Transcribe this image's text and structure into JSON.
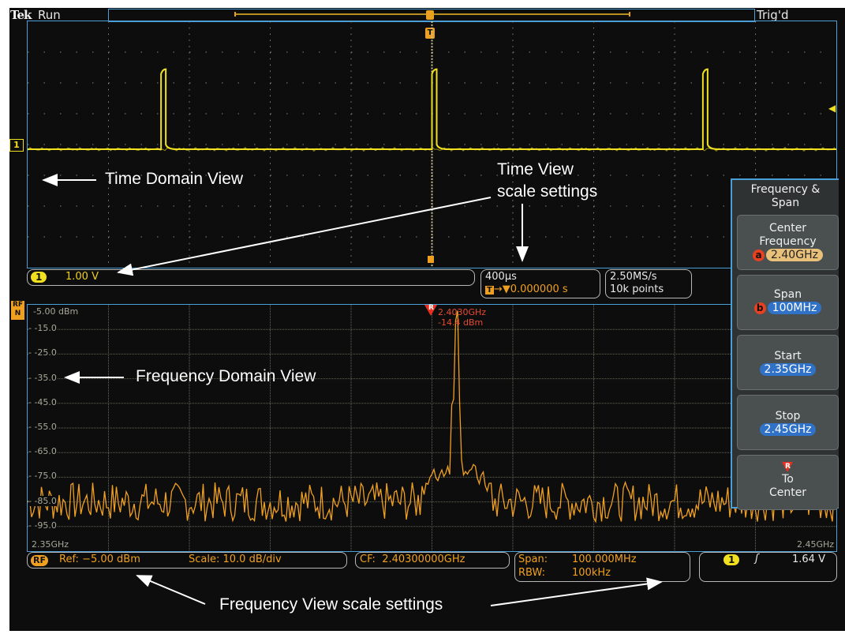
{
  "top_bar": {
    "brand": "Tek",
    "acq_state": "Run",
    "trigger_status": "Trig'd"
  },
  "time_domain": {
    "channel_marker": "1",
    "trigger_marker": "T",
    "channel_color": "#f0e020",
    "pulse_positions_div": [
      1.65,
      5.0,
      8.35
    ],
    "baseline_div_from_top": 4.0,
    "pulse_height_div": 2.6
  },
  "channel_readout": {
    "channel": "1",
    "scale": "1.00 V"
  },
  "horizontal_readout": {
    "time_per_div": "400µs",
    "trigger_icon": "T",
    "position": "0.000000 s"
  },
  "acquisition_readout": {
    "sample_rate": "2.50MS/s",
    "record_length": "10k points"
  },
  "frequency_domain": {
    "rf_marker_top": "RF",
    "rf_marker_bottom": "N",
    "ref_label": "-5.00 dBm",
    "y_tick_labels": [
      "-15.0",
      "-25.0",
      "-35.0",
      "-45.0",
      "-55.0",
      "-65.0",
      "-75.0",
      "-85.0",
      "-95.0"
    ],
    "start_label": "2.35GHz",
    "stop_label": "2.45GHz",
    "trace_color": "#f0a020",
    "marker": {
      "label": "R",
      "frequency": "2.4030GHz",
      "amplitude": "-14.4 dBm",
      "color": "#e83020"
    }
  },
  "chart_data": {
    "type": "line",
    "title": "Frequency Domain View",
    "xlabel": "Frequency",
    "ylabel": "dBm",
    "x_range_ghz": [
      2.35,
      2.45
    ],
    "ylim": [
      -105,
      -5
    ],
    "y_ticks": [
      -5,
      -15,
      -25,
      -35,
      -45,
      -55,
      -65,
      -75,
      -85,
      -95
    ],
    "grid": true,
    "peak": {
      "x_ghz": 2.403,
      "y_dbm": -14.4
    },
    "noise_floor_dbm": -85,
    "noise_range_dbm": [
      -98,
      -77
    ],
    "shoulder_dbm": -68
  },
  "rf_readout": {
    "badge": "RF",
    "ref": "Ref: −5.00 dBm",
    "scale": "Scale: 10.0 dB/div"
  },
  "cf_readout": {
    "text": "CF:  2.40300000GHz"
  },
  "span_readout": {
    "span_label": "Span:",
    "span_value": "100.000MHz",
    "rbw_label": "RBW:",
    "rbw_value": "100kHz"
  },
  "trigger_readout": {
    "channel": "1",
    "slope_icon": "rising-edge",
    "level": "1.64 V"
  },
  "side_menu": {
    "title_line1": "Frequency &",
    "title_line2": "Span",
    "buttons": [
      {
        "line1": "Center",
        "line2": "Frequency",
        "knob": "a",
        "value": "2.40GHz"
      },
      {
        "line1": "Span",
        "knob": "b",
        "value": "100MHz"
      },
      {
        "line1": "Start",
        "value": "2.35GHz"
      },
      {
        "line1": "Stop",
        "value": "2.45GHz"
      },
      {
        "marker": "R",
        "line1": "To",
        "line2": "Center"
      }
    ]
  },
  "annotations": {
    "time_domain": "Time Domain View",
    "time_scale_line1": "Time View",
    "time_scale_line2": "scale settings",
    "freq_domain": "Frequency Domain View",
    "freq_scale": "Frequency View scale settings"
  }
}
